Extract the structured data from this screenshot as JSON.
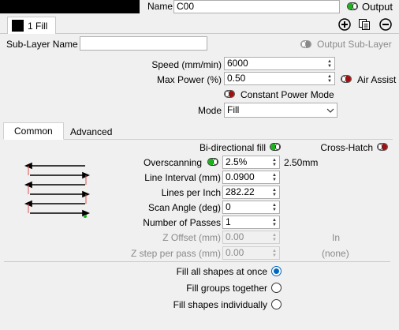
{
  "header": {
    "name_label": "Name",
    "name_value": "C00",
    "output_label": "Output"
  },
  "layer_tab": {
    "label": "1 Fill",
    "color": "#000000"
  },
  "sublayer": {
    "name_label": "Sub-Layer Name",
    "name_value": "",
    "output_sublayer_label": "Output Sub-Layer"
  },
  "speed": {
    "label": "Speed (mm/min)",
    "value": "6000"
  },
  "max_power": {
    "label": "Max Power (%)",
    "value": "0.50"
  },
  "air_assist": {
    "label": "Air Assist"
  },
  "constant_power": {
    "label": "Constant Power Mode"
  },
  "mode": {
    "label": "Mode",
    "value": "Fill"
  },
  "tabs": {
    "common": "Common",
    "advanced": "Advanced"
  },
  "bidirectional": {
    "label": "Bi-directional fill"
  },
  "cross_hatch": {
    "label": "Cross-Hatch"
  },
  "overscanning": {
    "label": "Overscanning",
    "value": "2.5%",
    "extra": "2.50mm"
  },
  "line_interval": {
    "label": "Line Interval (mm)",
    "value": "0.0900"
  },
  "lines_per_inch": {
    "label": "Lines per Inch",
    "value": "282.22"
  },
  "scan_angle": {
    "label": "Scan Angle (deg)",
    "value": "0"
  },
  "num_passes": {
    "label": "Number of Passes",
    "value": "1"
  },
  "z_offset": {
    "label": "Z Offset (mm)",
    "value": "0.00",
    "extra": "In"
  },
  "z_step": {
    "label": "Z step per pass (mm)",
    "value": "0.00",
    "extra": "(none)"
  },
  "fill_options": {
    "all_at_once": "Fill all shapes at once",
    "groups_together": "Fill groups together",
    "individually": "Fill shapes individually",
    "selected": "all_at_once"
  },
  "colors": {
    "toggle_on": "#1bb21b",
    "toggle_off": "#a01010",
    "radio_selected": "#0067c0",
    "preview_line_red": "#e05050"
  }
}
